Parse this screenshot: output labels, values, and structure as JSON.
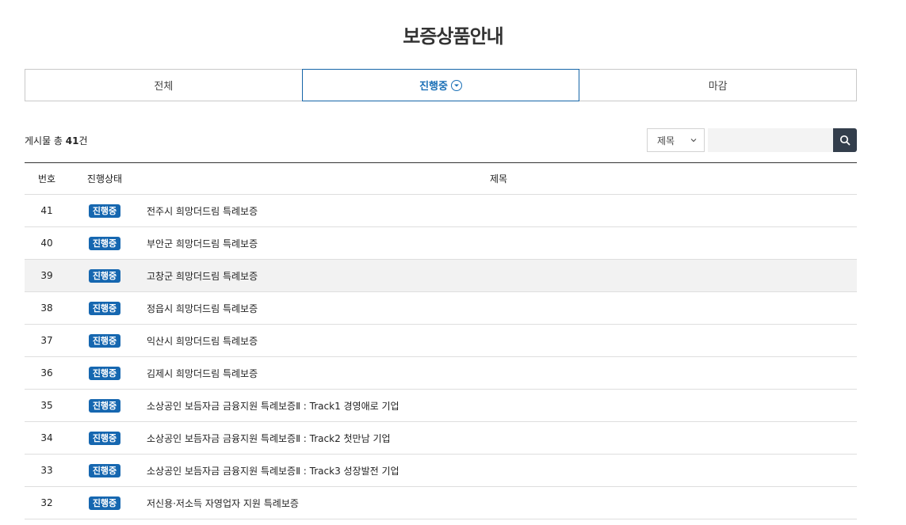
{
  "page": {
    "title": "보증상품안내"
  },
  "tabs": [
    {
      "label": "전체"
    },
    {
      "label": "진행중"
    },
    {
      "label": "마감"
    }
  ],
  "summary": {
    "prefix": "게시물 총 ",
    "count": "41",
    "suffix": "건"
  },
  "search": {
    "select_value": "제목",
    "input_value": "",
    "button_icon": "search-icon"
  },
  "colors": {
    "accent": "#1667b0",
    "search_button": "#333e4c"
  },
  "table": {
    "headers": {
      "num": "번호",
      "state": "진행상태",
      "title": "제목"
    },
    "rows": [
      {
        "num": "41",
        "state": "진행중",
        "title": "전주시 희망더드림 특례보증"
      },
      {
        "num": "40",
        "state": "진행중",
        "title": "부안군 희망더드림 특례보증"
      },
      {
        "num": "39",
        "state": "진행중",
        "title": "고창군 희망더드림 특례보증"
      },
      {
        "num": "38",
        "state": "진행중",
        "title": "정읍시 희망더드림 특례보증"
      },
      {
        "num": "37",
        "state": "진행중",
        "title": "익산시 희망더드림 특례보증"
      },
      {
        "num": "36",
        "state": "진행중",
        "title": "김제시 희망더드림 특례보증"
      },
      {
        "num": "35",
        "state": "진행중",
        "title": "소상공인 보듬자금 금융지원 특례보증Ⅱ : Track1 경영애로 기업"
      },
      {
        "num": "34",
        "state": "진행중",
        "title": "소상공인 보듬자금 금융지원 특례보증Ⅱ : Track2 첫만남 기업"
      },
      {
        "num": "33",
        "state": "진행중",
        "title": "소상공인 보듬자금 금융지원 특례보증Ⅱ : Track3 성장발전 기업"
      },
      {
        "num": "32",
        "state": "진행중",
        "title": "저신용·저소득 자영업자 지원 특례보증"
      }
    ]
  }
}
